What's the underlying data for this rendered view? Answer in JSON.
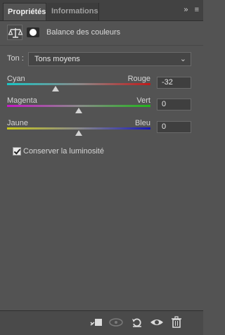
{
  "tabs": [
    "Propriétés",
    "Informations"
  ],
  "tab_controls": {
    "collapse": "»",
    "menu": "≡"
  },
  "header": {
    "title": "Balance des couleurs"
  },
  "tone": {
    "label": "Ton :",
    "value": "Tons moyens"
  },
  "sliders": [
    {
      "left": "Cyan",
      "right": "Rouge",
      "value": "-32",
      "level": -32,
      "gradient": [
        "#19c6c6",
        "#c01a1a"
      ]
    },
    {
      "left": "Magenta",
      "right": "Vert",
      "value": "0",
      "level": 0,
      "gradient": [
        "#c718c7",
        "#21b51c"
      ]
    },
    {
      "left": "Jaune",
      "right": "Bleu",
      "value": "0",
      "level": 0,
      "gradient": [
        "#c8c81a",
        "#1818b8"
      ]
    }
  ],
  "preserve_luminosity": {
    "label": "Conserver la luminosité",
    "checked": true
  },
  "bottom_icons": [
    "clip-to-layer-icon",
    "view-previous-state-icon",
    "reset-icon",
    "visibility-eye-icon",
    "trash-icon"
  ]
}
